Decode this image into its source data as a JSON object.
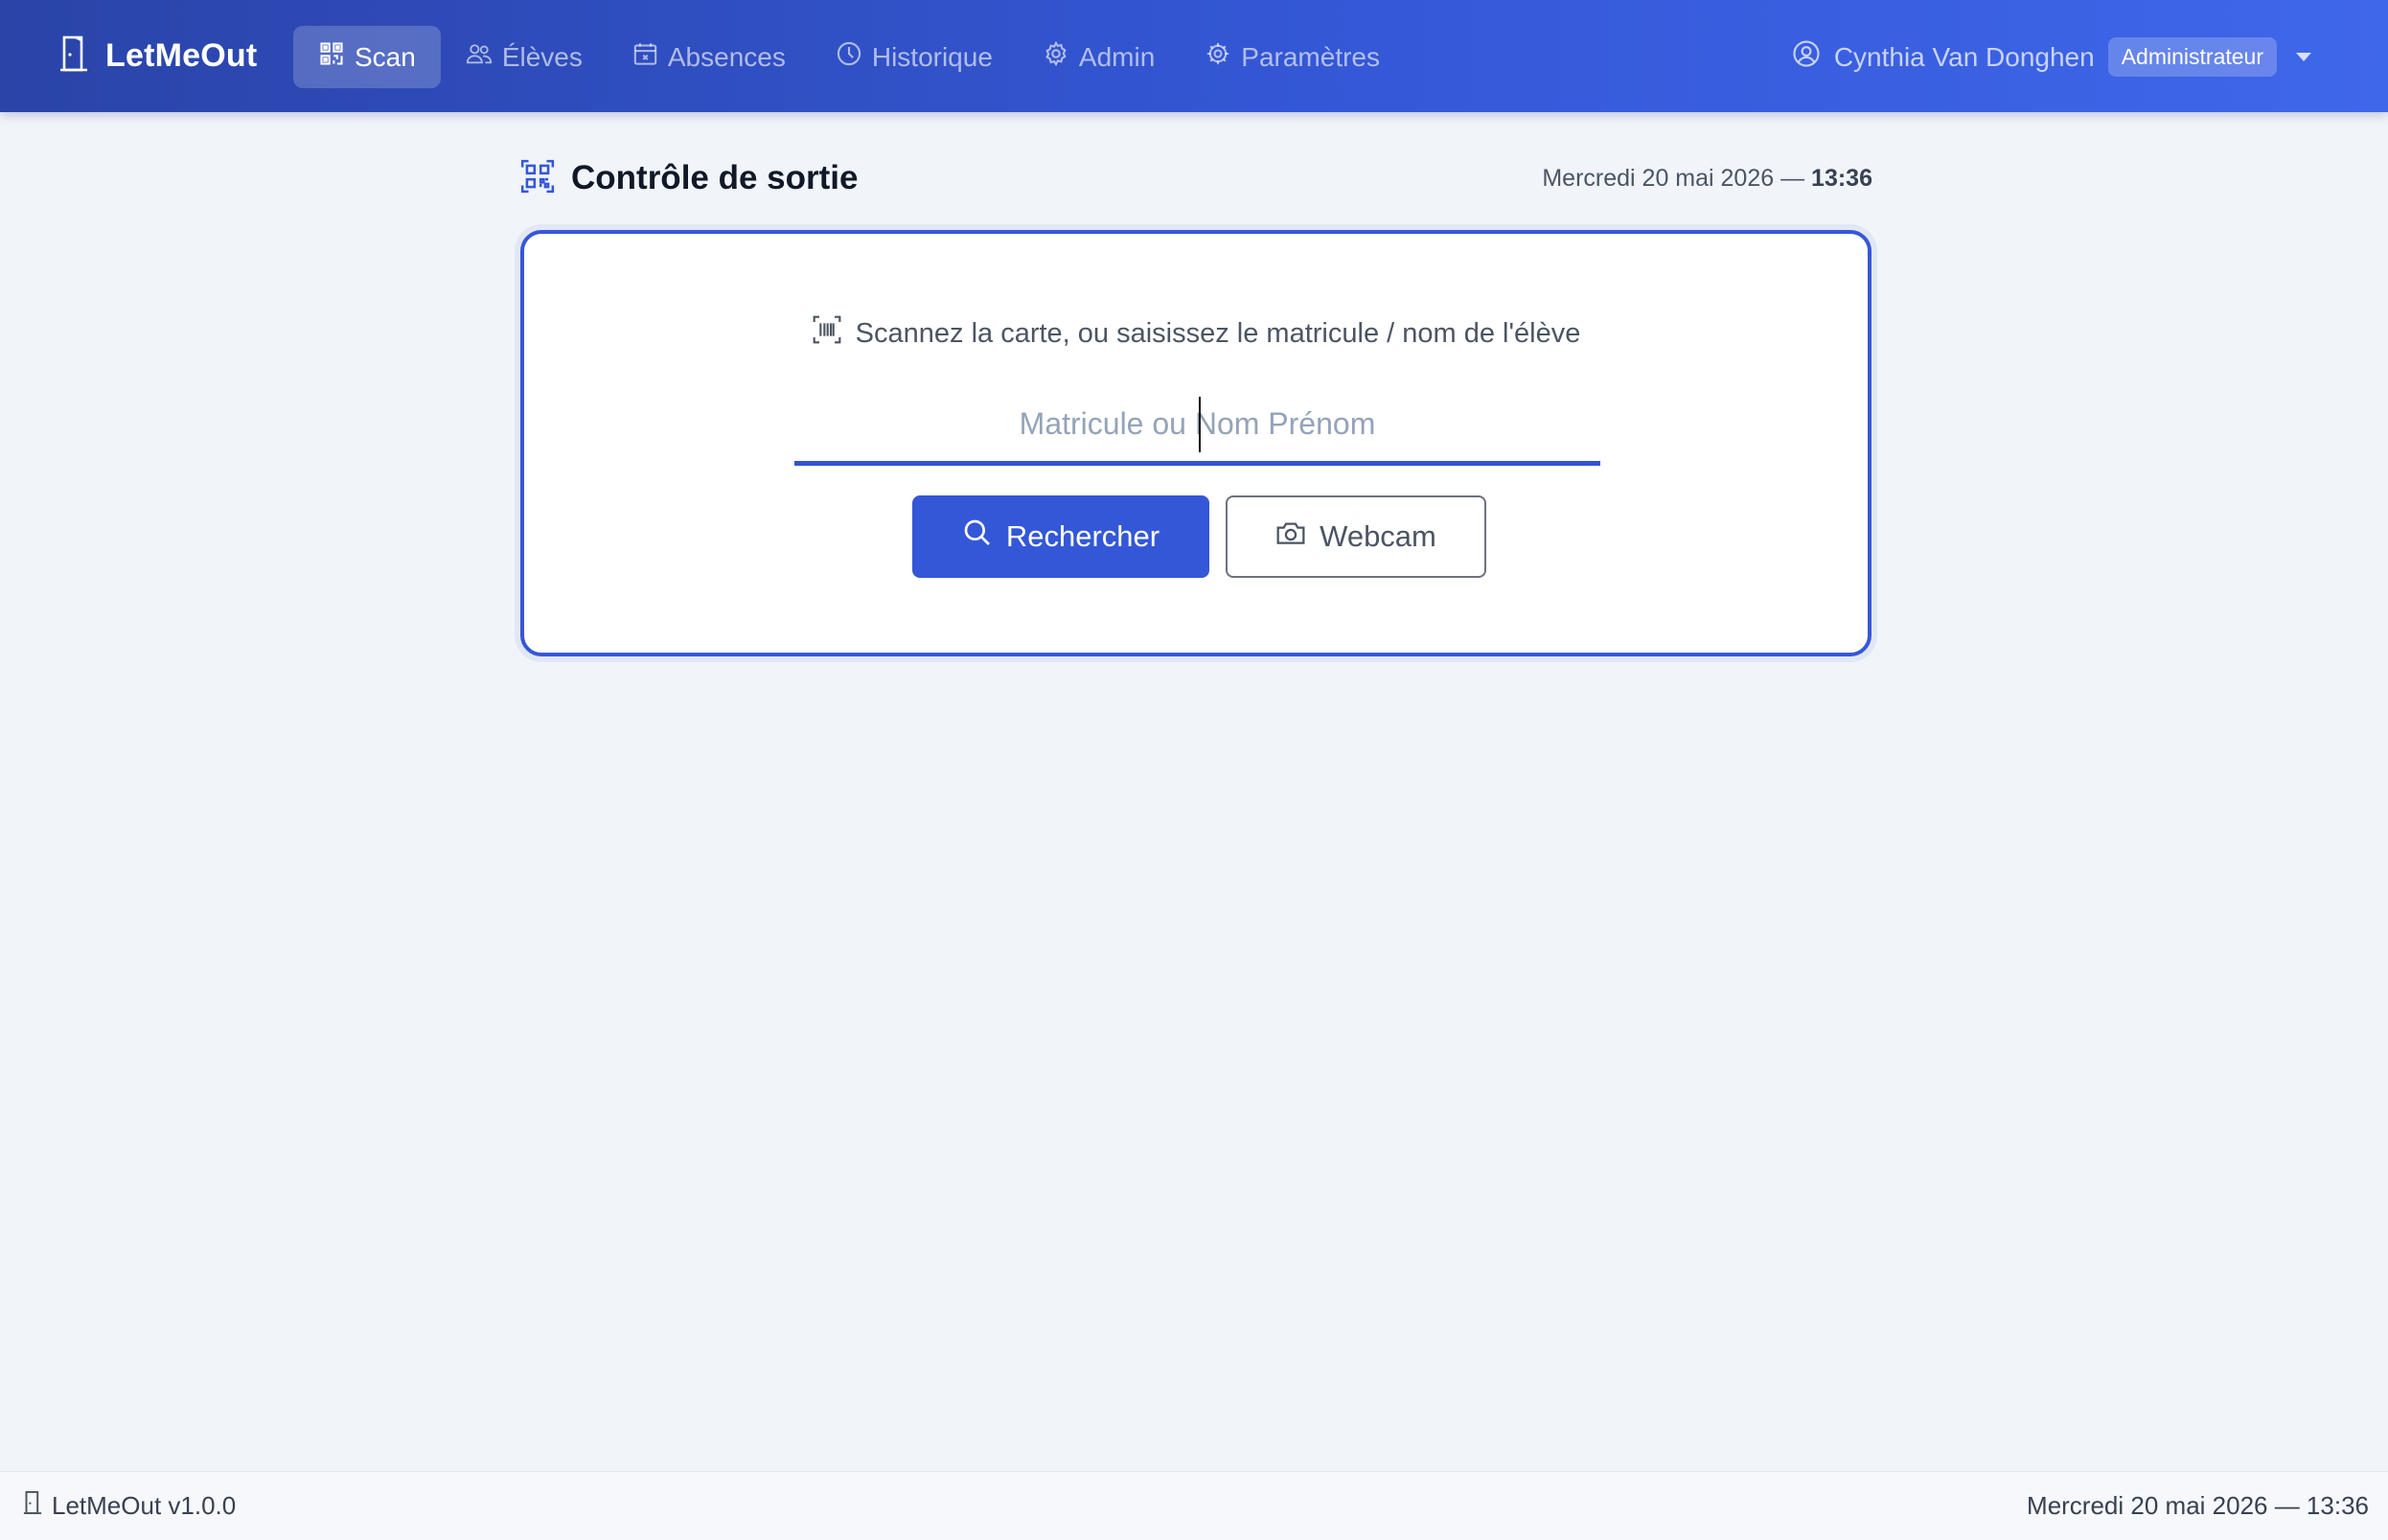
{
  "app": {
    "name": "LetMeOut",
    "version_label": "LetMeOut v1.0.0"
  },
  "nav": {
    "items": [
      {
        "label": "Scan",
        "icon": "qr-code-icon",
        "active": true
      },
      {
        "label": "Élèves",
        "icon": "users-icon",
        "active": false
      },
      {
        "label": "Absences",
        "icon": "calendar-x-icon",
        "active": false
      },
      {
        "label": "Historique",
        "icon": "clock-icon",
        "active": false
      },
      {
        "label": "Admin",
        "icon": "gear-icon",
        "active": false
      },
      {
        "label": "Paramètres",
        "icon": "settings-icon",
        "active": false
      }
    ]
  },
  "user": {
    "name": "Cynthia Van Donghen",
    "role": "Administrateur",
    "icon": "user-circle-icon"
  },
  "header": {
    "title": "Contrôle de sortie",
    "date": "Mercredi 20 mai 2026 — ",
    "time": "13:36"
  },
  "scan": {
    "instruction": "Scannez la carte, ou saisissez le matricule / nom de l'élève",
    "placeholder": "Matricule ou Nom Prénom",
    "value": "",
    "search_label": "Rechercher",
    "webcam_label": "Webcam"
  },
  "footer": {
    "datetime": "Mercredi 20 mai 2026 — 13:36"
  },
  "colors": {
    "primary": "#3457d8",
    "nav_start": "#2a44a8",
    "nav_end": "#3f67ea",
    "background": "#f1f4f9"
  }
}
